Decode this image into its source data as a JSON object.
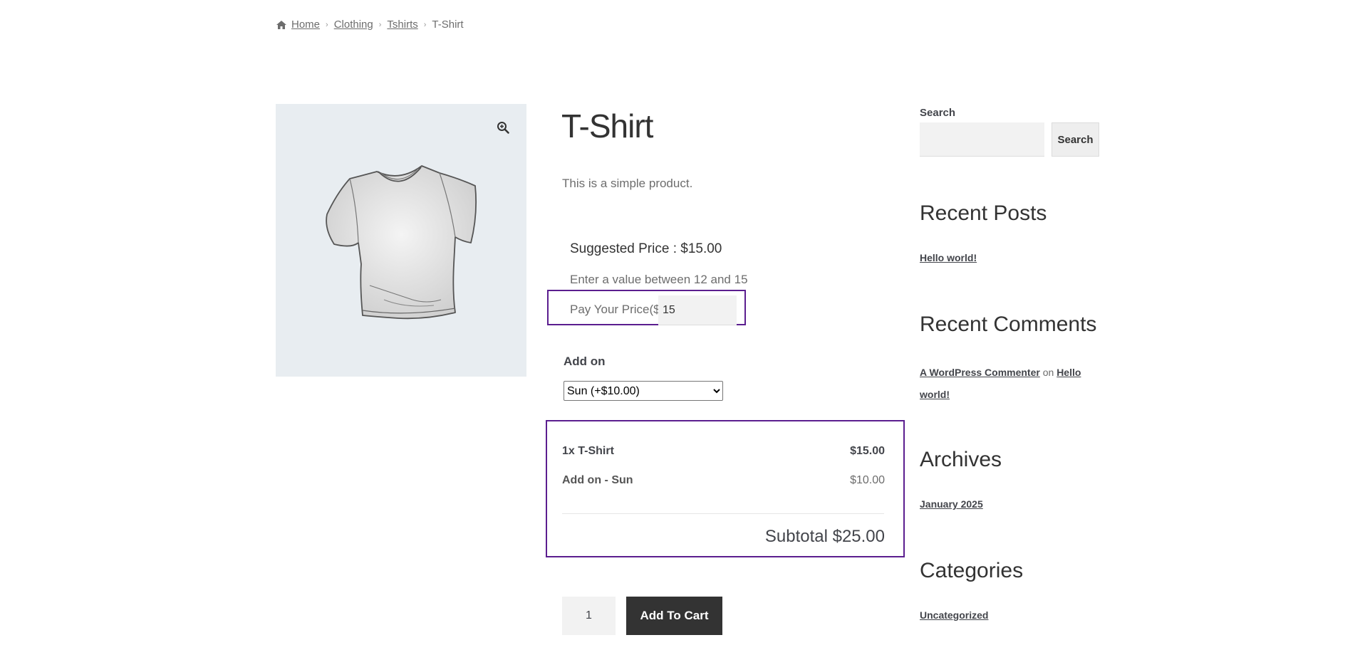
{
  "breadcrumb": {
    "items": [
      "Home",
      "Clothing",
      "Tshirts"
    ],
    "current": "T-Shirt",
    "separator": "›"
  },
  "product": {
    "title": "T-Shirt",
    "description": "This is a simple product."
  },
  "pricing": {
    "suggested": "Suggested Price : $15.00",
    "range_hint": "Enter a value between 12 and 15",
    "pay_label": "Pay Your Price($)",
    "pay_value": "15"
  },
  "addon": {
    "label": "Add on",
    "selected": "Sun (+$10.00)"
  },
  "totals": {
    "line1_label": "1x T-Shirt",
    "line1_value": "$15.00",
    "line2_label": "Add on - Sun",
    "line2_value": "$10.00",
    "subtotal": "Subtotal $25.00"
  },
  "cart": {
    "quantity": "1",
    "add_label": "Add To Cart"
  },
  "sidebar": {
    "search_label": "Search",
    "search_button": "Search",
    "recent_posts_title": "Recent Posts",
    "recent_post": "Hello world!",
    "recent_comments_title": "Recent Comments",
    "commenter": "A WordPress Commenter",
    "comment_on": "on",
    "comment_post": "Hello world!",
    "archives_title": "Archives",
    "archive_item": "January 2025",
    "categories_title": "Categories",
    "category_item": "Uncategorized"
  },
  "colors": {
    "highlight_border": "#5b1e8f",
    "button_dark": "#333333",
    "image_bg": "#e8edf1"
  },
  "icons": [
    "home-icon",
    "zoom-icon"
  ]
}
